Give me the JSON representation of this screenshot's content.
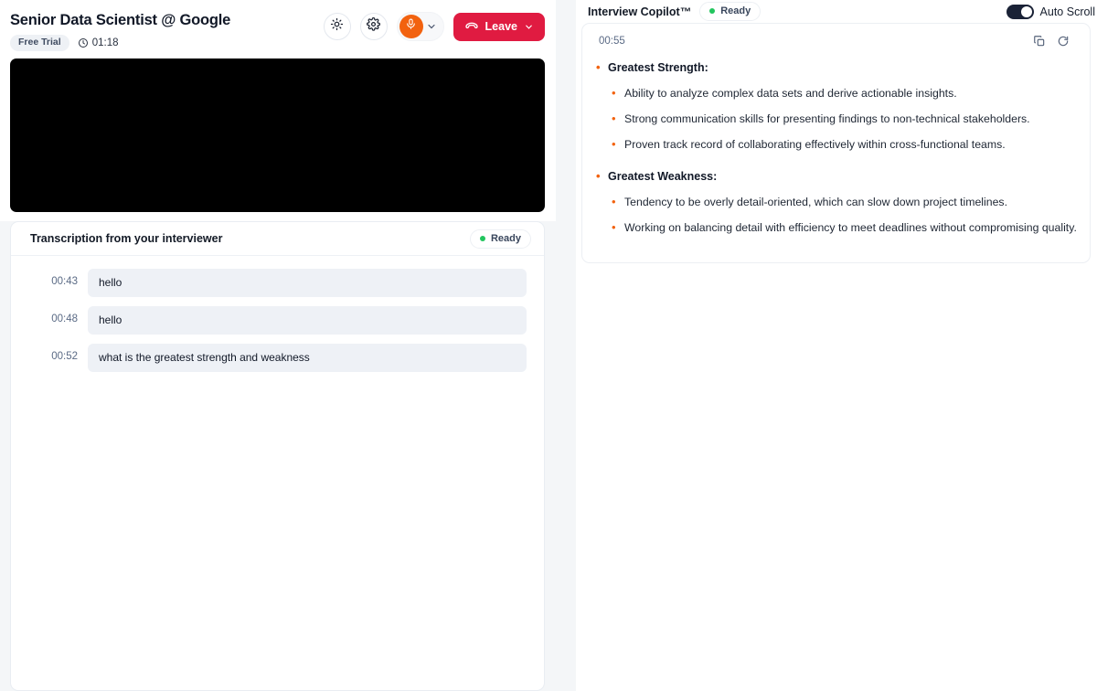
{
  "left": {
    "header": {
      "job_title": "Senior Data Scientist @ Google",
      "trial_badge": "Free Trial",
      "elapsed_time": "01:18",
      "clock_icon": "clock-icon",
      "brightness_icon": "sun-icon",
      "settings_icon": "gear-icon",
      "mic_icon": "microphone-icon",
      "mic_chevron_icon": "chevron-down-icon",
      "leave_label": "Leave",
      "leave_icon": "phone-hangup-icon",
      "leave_chevron_icon": "chevron-down-icon",
      "leave_color": "#e01b41",
      "mic_color": "#f2620f"
    },
    "video": {
      "name": "video-preview"
    },
    "transcription": {
      "title": "Transcription from your interviewer",
      "status": "Ready",
      "status_color": "#22c55e",
      "rows": [
        {
          "time": "00:43",
          "text": "hello"
        },
        {
          "time": "00:48",
          "text": "hello"
        },
        {
          "time": "00:52",
          "text": "what is the greatest strength and weakness"
        }
      ]
    }
  },
  "right": {
    "header": {
      "title": "Interview Copilot™",
      "status": "Ready",
      "status_color": "#22c55e",
      "auto_scroll_label": "Auto Scroll",
      "auto_scroll_on": true
    },
    "answer": {
      "time": "00:55",
      "copy_icon": "copy-icon",
      "refresh_icon": "refresh-icon",
      "bullet_color": "#f2620f",
      "sections": [
        {
          "heading": "Greatest Strength:",
          "points": [
            "Ability to analyze complex data sets and derive actionable insights.",
            "Strong communication skills for presenting findings to non-technical stakeholders.",
            "Proven track record of collaborating effectively within cross-functional teams."
          ]
        },
        {
          "heading": "Greatest Weakness:",
          "points": [
            "Tendency to be overly detail-oriented, which can slow down project timelines.",
            "Working on balancing detail with efficiency to meet deadlines without compromising quality."
          ]
        }
      ]
    }
  }
}
